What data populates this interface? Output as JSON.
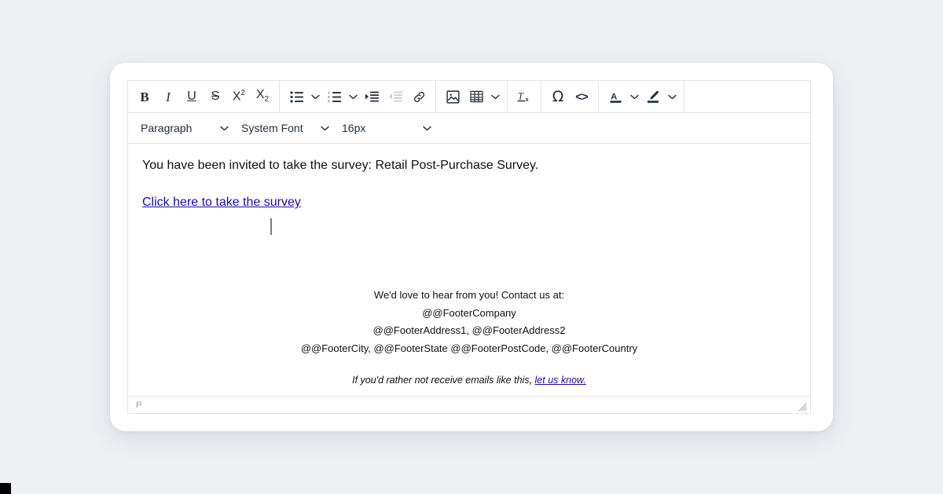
{
  "colors": {
    "page_background": "#eef0f4",
    "card_background": "#ffffff",
    "border": "#e3e6ea",
    "icon": "#222f3e",
    "icon_disabled": "#c6cdd5",
    "link": "#1a0dab",
    "caret": "#7a7a7a",
    "status_text": "#9aa3ad"
  },
  "toolbar": {
    "groups": [
      {
        "name": "formatting",
        "items": [
          {
            "id": "bold",
            "icon": "bold-icon",
            "label": "B",
            "disabled": false
          },
          {
            "id": "italic",
            "icon": "italic-icon",
            "label": "I",
            "disabled": false
          },
          {
            "id": "underline",
            "icon": "underline-icon",
            "label": "U",
            "disabled": false
          },
          {
            "id": "strikethrough",
            "icon": "strikethrough-icon",
            "label": "S",
            "disabled": false
          },
          {
            "id": "superscript",
            "icon": "superscript-icon",
            "label": "X2",
            "disabled": false
          },
          {
            "id": "subscript",
            "icon": "subscript-icon",
            "label": "X2",
            "disabled": false
          }
        ]
      },
      {
        "name": "lists-indent",
        "items": [
          {
            "id": "bullet-list",
            "icon": "bullet-list-icon",
            "label": "",
            "disabled": false
          },
          {
            "id": "bullet-list-options",
            "icon": "chevron-down-icon",
            "label": "",
            "disabled": false
          },
          {
            "id": "numbered-list",
            "icon": "numbered-list-icon",
            "label": "",
            "disabled": false
          },
          {
            "id": "numbered-list-options",
            "icon": "chevron-down-icon",
            "label": "",
            "disabled": false
          },
          {
            "id": "indent",
            "icon": "increase-indent-icon",
            "label": "",
            "disabled": false
          },
          {
            "id": "outdent",
            "icon": "decrease-indent-icon",
            "label": "",
            "disabled": true
          },
          {
            "id": "link",
            "icon": "link-icon",
            "label": "",
            "disabled": false
          }
        ]
      },
      {
        "name": "insert",
        "items": [
          {
            "id": "insert-image",
            "icon": "image-icon",
            "label": "",
            "disabled": false
          },
          {
            "id": "insert-table",
            "icon": "table-icon",
            "label": "",
            "disabled": false
          },
          {
            "id": "table-options",
            "icon": "chevron-down-icon",
            "label": "",
            "disabled": false
          }
        ]
      },
      {
        "name": "clear-formatting",
        "items": [
          {
            "id": "clear-formatting",
            "icon": "clear-formatting-icon",
            "label": "",
            "disabled": false
          }
        ]
      },
      {
        "name": "special",
        "items": [
          {
            "id": "special-character",
            "icon": "omega-icon",
            "label": "Ω",
            "disabled": false
          },
          {
            "id": "source-code",
            "icon": "source-code-icon",
            "label": "<>",
            "disabled": false
          }
        ]
      },
      {
        "name": "colors",
        "items": [
          {
            "id": "text-color",
            "icon": "text-color-icon",
            "label": "A",
            "disabled": false
          },
          {
            "id": "text-color-options",
            "icon": "chevron-down-icon",
            "label": "",
            "disabled": false
          },
          {
            "id": "highlight-color",
            "icon": "highlight-color-icon",
            "label": "",
            "disabled": false
          },
          {
            "id": "highlight-color-options",
            "icon": "chevron-down-icon",
            "label": "",
            "disabled": false
          }
        ]
      }
    ],
    "selects": [
      {
        "id": "block-format",
        "name": "block-format-select",
        "value": "Paragraph"
      },
      {
        "id": "font-family",
        "name": "font-family-select",
        "value": "System Font"
      },
      {
        "id": "font-size",
        "name": "font-size-select",
        "value": "16px"
      }
    ]
  },
  "editor": {
    "body": {
      "intro": "You have been invited to take the survey: Retail Post-Purchase Survey.",
      "survey_link": "Click here to take the survey",
      "footer_lines": [
        "We'd love to hear from you! Contact us at:",
        "@@FooterCompany",
        "@@FooterAddress1, @@FooterAddress2",
        "@@FooterCity, @@FooterState @@FooterPostCode, @@FooterCountry"
      ],
      "unsubscribe_text": "If you'd rather not receive emails like this,",
      "unsubscribe_link": "let us know."
    }
  },
  "statusbar": {
    "element_path": "P",
    "resize_handle": "resize-grip-icon"
  }
}
